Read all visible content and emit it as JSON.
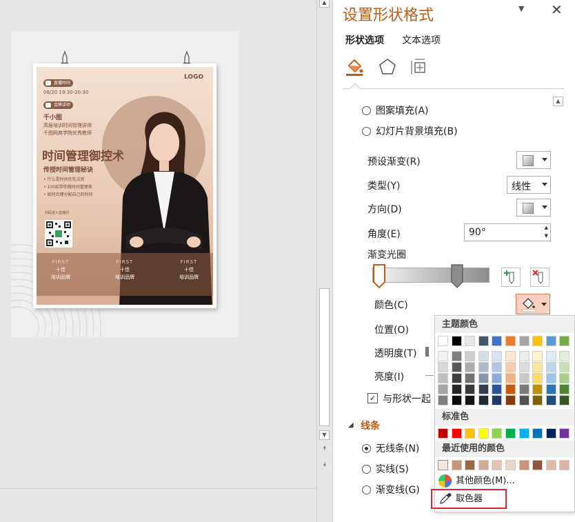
{
  "pane": {
    "title": "设置形状格式",
    "tabs": [
      {
        "label": "形状选项"
      },
      {
        "label": "文本选项"
      }
    ]
  },
  "fill_options": {
    "pattern_fill": "图案填充(A)",
    "slide_bg_fill": "幻灯片背景填充(B)"
  },
  "gradient": {
    "preset_label": "预设渐变(R)",
    "type_label": "类型(Y)",
    "type_value": "线性",
    "direction_label": "方向(D)",
    "angle_label": "角度(E)",
    "angle_value": "90°",
    "stops_label": "渐变光圈",
    "color_label": "颜色(C)",
    "position_label": "位置(O)",
    "transparency_label": "透明度(T)",
    "brightness_label": "亮度(I)",
    "rotate_with_shape_label": "与形状一起"
  },
  "lines": {
    "section_label": "线条",
    "no_line": "无线条(N)",
    "solid_line": "实线(S)",
    "gradient_line": "渐变线(G)"
  },
  "color_popup": {
    "theme_colors_label": "主题颜色",
    "theme_top_row": [
      "#ffffff",
      "#000000",
      "#e7e6e6",
      "#44546a",
      "#4472c4",
      "#ed7d31",
      "#a5a5a5",
      "#ffc000",
      "#5b9bd5",
      "#70ad47"
    ],
    "theme_tints": [
      [
        "#f2f2f2",
        "#7f7f7f",
        "#d0cece",
        "#d6dce4",
        "#d9e2f3",
        "#fbe5d5",
        "#ededed",
        "#fff2cc",
        "#deebf6",
        "#e2efd9"
      ],
      [
        "#d8d8d8",
        "#595959",
        "#aeabab",
        "#adb9ca",
        "#b4c6e7",
        "#f7cbac",
        "#dbdbdb",
        "#fee599",
        "#bdd7ee",
        "#c5e0b3"
      ],
      [
        "#bfbfbf",
        "#3f3f3f",
        "#757070",
        "#8496b0",
        "#8eaadb",
        "#f4b183",
        "#c9c9c9",
        "#ffd965",
        "#9dc3e6",
        "#a8d08d"
      ],
      [
        "#a5a5a5",
        "#262626",
        "#3a3838",
        "#323f4f",
        "#2f5496",
        "#c55a11",
        "#7b7b7b",
        "#bf9000",
        "#2e75b5",
        "#538135"
      ],
      [
        "#7f7f7f",
        "#0c0c0c",
        "#171616",
        "#222a35",
        "#1f3864",
        "#833c0b",
        "#525252",
        "#7f6000",
        "#1e4e79",
        "#375623"
      ]
    ],
    "standard_colors_label": "标准色",
    "standard_colors": [
      "#c00000",
      "#ff0000",
      "#ffc000",
      "#ffff00",
      "#92d050",
      "#00b050",
      "#00b0f0",
      "#0070c0",
      "#002060",
      "#7030a0"
    ],
    "recent_colors_label": "最近使用的颜色",
    "recent_colors": [
      "#f4e6dc",
      "#c4957a",
      "#9b6848",
      "#d6ab94",
      "#e2c2b2",
      "#e9d5cc",
      "#c9927a",
      "#8f563b",
      "#dfb8a6",
      "#d9b3a3"
    ],
    "more_colors": "其他颜色(M)...",
    "eyedropper": "取色器"
  },
  "poster": {
    "logo": "LOGO",
    "live_tag": "直播时间",
    "datetime": "08/20  19:30-20:30",
    "lecturer_tag": "金牌讲师",
    "name": "千小图",
    "bio_1": "高层培训时间管理讲师",
    "bio_2": "千图网商学院优秀教师",
    "headline": "时间管理御控术",
    "subheadline": "传授时间管理秘诀",
    "bullet_1": "• 什么是时间优先法则",
    "bullet_2": "• 100招带你做时间管理表",
    "bullet_3": "• 如何合理分配自己的时间",
    "qr_caption": "扫码进入直播间",
    "band_first": "FIRST",
    "band_top": "十佳",
    "band_bottom": "培训品牌"
  }
}
